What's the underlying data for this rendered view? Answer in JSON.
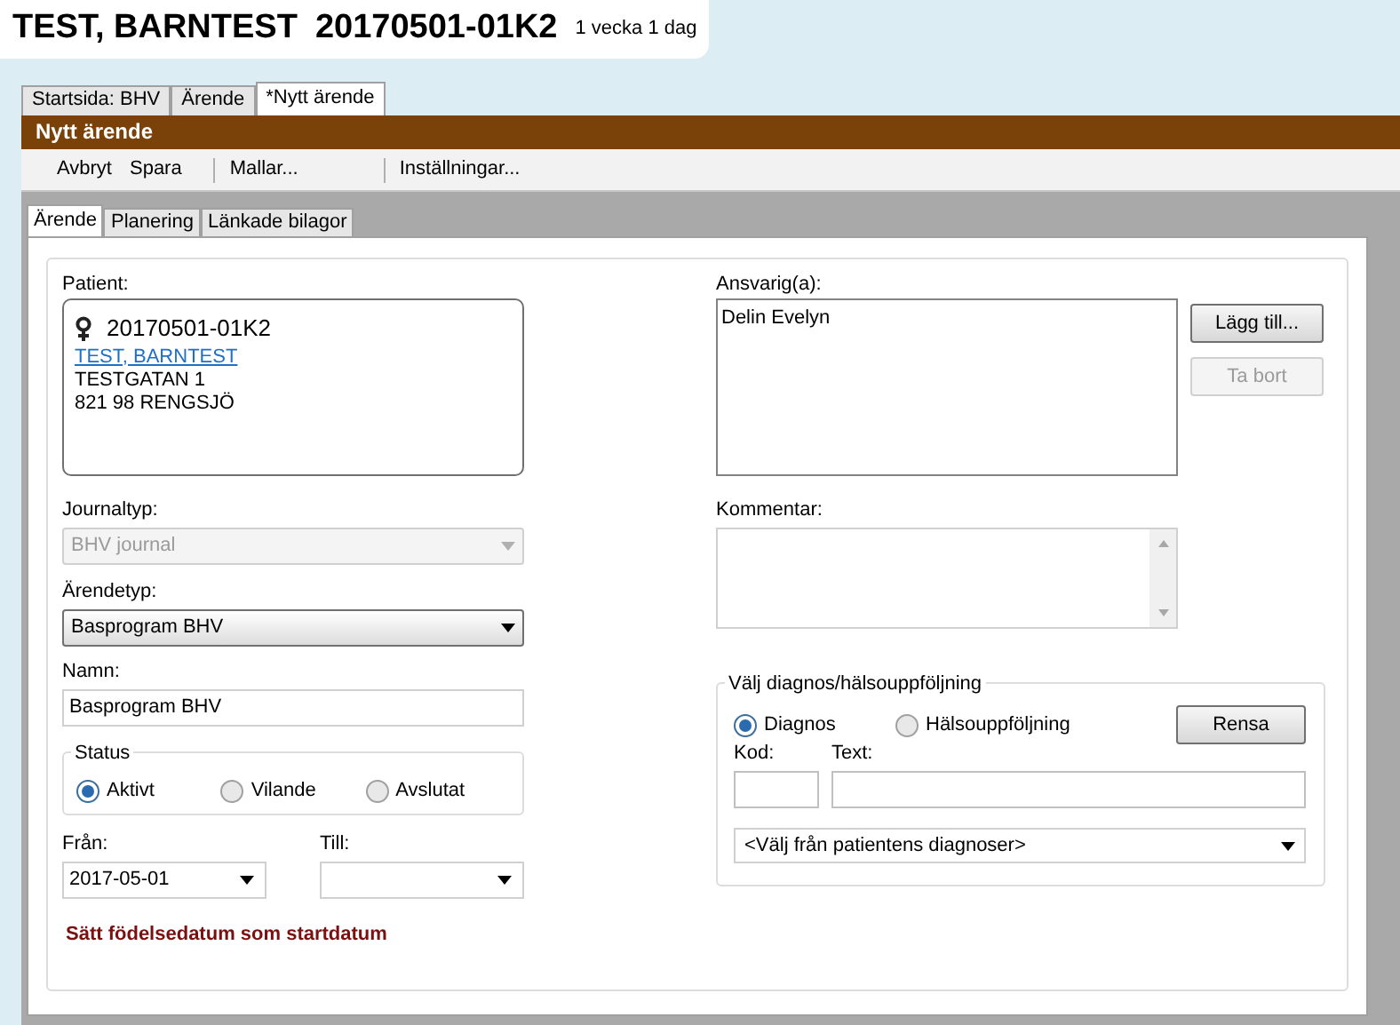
{
  "header": {
    "name": "TEST, BARNTEST",
    "id": "20170501-01K2",
    "age": "1 vecka 1 dag"
  },
  "top_tabs": [
    {
      "label": "Startsida: BHV",
      "selected": false
    },
    {
      "label": "Ärende",
      "selected": false
    },
    {
      "label": "*Nytt ärende",
      "selected": true
    }
  ],
  "panel_title": "Nytt ärende",
  "toolbar": [
    [
      "Avbryt",
      "Spara"
    ],
    [
      "Mallar..."
    ],
    [
      "Inställningar..."
    ]
  ],
  "inner_tabs": [
    {
      "label": "Ärende",
      "selected": true
    },
    {
      "label": "Planering",
      "selected": false
    },
    {
      "label": "Länkade bilagor",
      "selected": false
    }
  ],
  "patient": {
    "label": "Patient:",
    "id": "20170501-01K2",
    "name": "TEST, BARNTEST",
    "address": [
      "TESTGATAN 1",
      "821 98 RENGSJÖ"
    ]
  },
  "journaltyp": {
    "label": "Journaltyp:",
    "value": "BHV journal",
    "disabled": true
  },
  "arendetyp": {
    "label": "Ärendetyp:",
    "value": "Basprogram BHV",
    "disabled": false
  },
  "namn": {
    "label": "Namn:",
    "value": "Basprogram BHV"
  },
  "status": {
    "legend": "Status",
    "options": [
      {
        "label": "Aktivt",
        "selected": true
      },
      {
        "label": "Vilande",
        "selected": false
      },
      {
        "label": "Avslutat",
        "selected": false
      }
    ]
  },
  "fran": {
    "label": "Från:",
    "value": "2017-05-01"
  },
  "till": {
    "label": "Till:"
  },
  "birthdate_link": "Sätt födelsedatum som startdatum",
  "ansvarig": {
    "label": "Ansvarig(a):",
    "items": [
      "Delin Evelyn"
    ],
    "buttons": [
      {
        "label": "Lägg till...",
        "disabled": false
      },
      {
        "label": "Ta bort",
        "disabled": true
      }
    ]
  },
  "kommentar": {
    "label": "Kommentar:"
  },
  "diagnos": {
    "legend": "Välj diagnos/hälsouppföljning",
    "options": [
      {
        "label": "Diagnos",
        "selected": true
      },
      {
        "label": "Hälsouppföljning",
        "selected": false
      }
    ],
    "clear_button": "Rensa",
    "kod_label": "Kod:",
    "text_label": "Text:",
    "select_placeholder": "<Välj från patientens diagnoser>"
  }
}
